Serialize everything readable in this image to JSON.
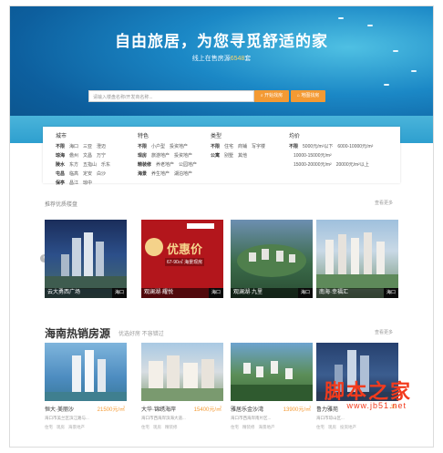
{
  "hero": {
    "title": "自由旅居，为您寻觅舒适的家",
    "sub_prefix": "线上在售房源",
    "sub_count": "6548",
    "sub_suffix": "套"
  },
  "search": {
    "placeholder": "请输入楼盘名称/开发商名称...",
    "btn_search": "开始找房",
    "btn_map": "地图找房"
  },
  "filter": {
    "city": {
      "title": "城市",
      "rows": [
        [
          "不限",
          "海口",
          "三亚",
          "澄迈"
        ],
        [
          "琼海",
          "儋州",
          "文昌",
          "万宁"
        ],
        [
          "陵水",
          "东方",
          "五指山",
          "乐东"
        ],
        [
          "屯昌",
          "临高",
          "定安",
          "白沙"
        ],
        [
          "保亭",
          "昌江",
          "琼中"
        ]
      ]
    },
    "feature": {
      "title": "特色",
      "rows": [
        [
          "不限",
          "小户型",
          "投资地产"
        ],
        [
          "现房",
          "旅游地产",
          "投资地产"
        ],
        [
          "精装修",
          "养老地产",
          "公园地产"
        ],
        [
          "海景",
          "养生地产",
          "湖泊地产"
        ]
      ]
    },
    "type": {
      "title": "类型",
      "rows": [
        [
          "不限",
          "住宅",
          "商铺",
          "写字楼"
        ],
        [
          "公寓",
          "别墅",
          "其他"
        ]
      ]
    },
    "price": {
      "title": "均价",
      "rows": [
        [
          "不限",
          "5000元/m²以下",
          "6000-10000元/m²"
        ],
        [
          "",
          "10000-15000元/m²"
        ],
        [
          "",
          "15000-20000元/m²",
          "20000元/m²以上"
        ]
      ]
    }
  },
  "recommend": {
    "title": "推荐优质楼盘",
    "more": "查看更多",
    "cards": [
      {
        "name": "云大勇西广场",
        "tag": "海口"
      },
      {
        "name": "观澜湖·耀悦",
        "tag": "海口"
      },
      {
        "name": "观澜湖·九里",
        "tag": "海口"
      },
      {
        "name": "南海·幸福汇",
        "tag": "海口"
      }
    ],
    "banner_text": "优惠价",
    "banner_sub": "67-90㎡ 海景现房"
  },
  "hot": {
    "title": "海南热销房源",
    "subtitle": "优选好房 不容错过",
    "more": "查看更多",
    "cards": [
      {
        "name": "恒大·美丽沙",
        "price": "21500元/㎡",
        "addr": "海口市美兰区滨江路与...",
        "tags": [
          "住宅",
          "现房",
          "海景地产"
        ]
      },
      {
        "name": "大华·锦绣海岸",
        "price": "15400元/㎡",
        "addr": "海口市西海岸滨海大道...",
        "tags": [
          "住宅",
          "现房",
          "精装修"
        ]
      },
      {
        "name": "雅居乐金沙湾",
        "price": "13900元/㎡",
        "addr": "海口市西海岸南片区...",
        "tags": [
          "住宅",
          "精装修",
          "海景地产"
        ]
      },
      {
        "name": "鲁力雅苑",
        "price": "15",
        "addr": "海口市琼山区...",
        "tags": [
          "住宅",
          "现房",
          "投资地产"
        ]
      }
    ]
  },
  "watermark": {
    "main": "脚本之家",
    "url": "www.jb51.net"
  },
  "colors": {
    "accent": "#f49a33",
    "sea": "#1b88c6",
    "watermark": "#f23b1d"
  }
}
